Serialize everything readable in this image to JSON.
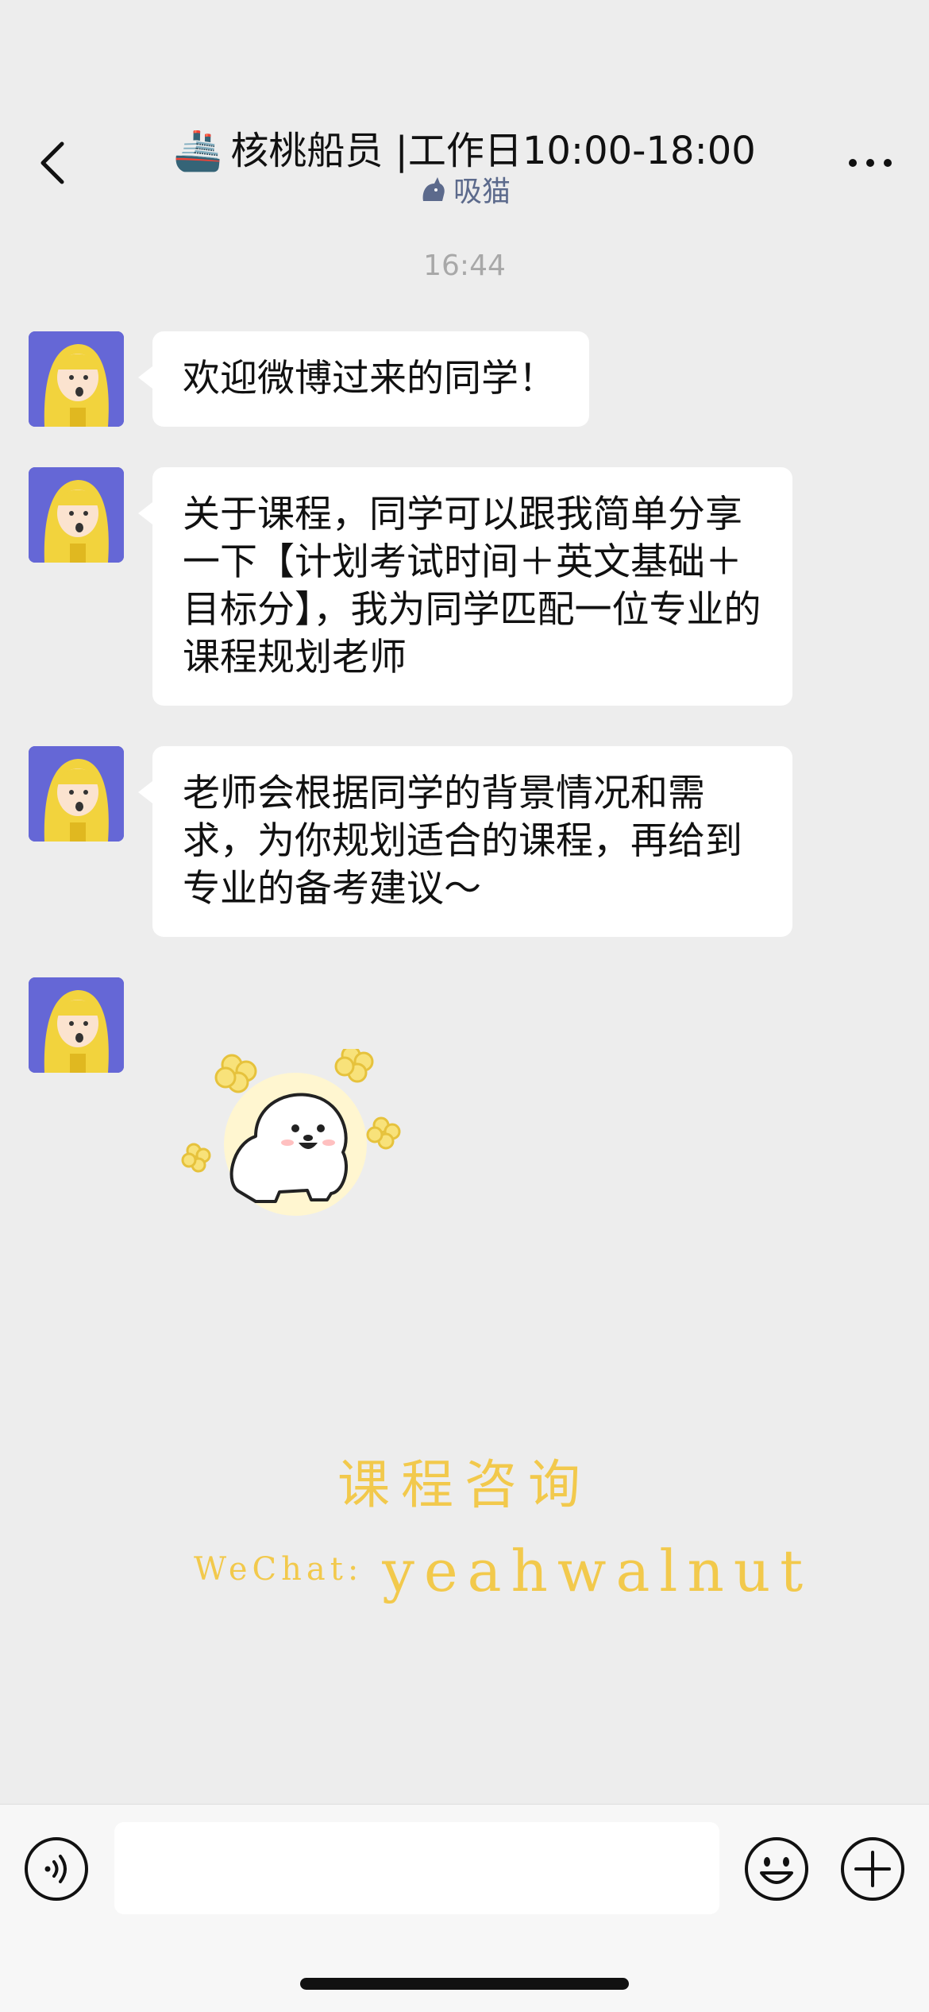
{
  "header": {
    "title_emoji": "🚢",
    "title": "核桃船员 |工作日10:00-18:00",
    "subtitle": "吸猫",
    "back_icon": "chevron-left-icon",
    "more_icon": "more-dots-icon"
  },
  "chat": {
    "timestamp": "16:44",
    "messages": [
      {
        "text": "欢迎微博过来的同学！"
      },
      {
        "text": "关于课程，同学可以跟我简单分享一下【计划考试时间＋英文基础＋目标分】，我为同学匹配一位专业的课程规划老师"
      },
      {
        "text": "老师会根据同学的背景情况和需求，为你规划适合的课程，再给到专业的备考建议～"
      },
      {
        "sticker": "dog-sticker"
      }
    ]
  },
  "watermark": {
    "title": "课程咨询",
    "label": "WeChat:",
    "id": "yeahwalnut"
  },
  "input_bar": {
    "voice_icon": "voice-icon",
    "emoji_icon": "emoji-icon",
    "plus_icon": "plus-icon",
    "input_value": ""
  },
  "colors": {
    "background": "#ededed",
    "bubble": "#ffffff",
    "watermark": "#f2c94c",
    "avatar_bg": "#6567d6",
    "subtitle": "#5c6a8c"
  }
}
